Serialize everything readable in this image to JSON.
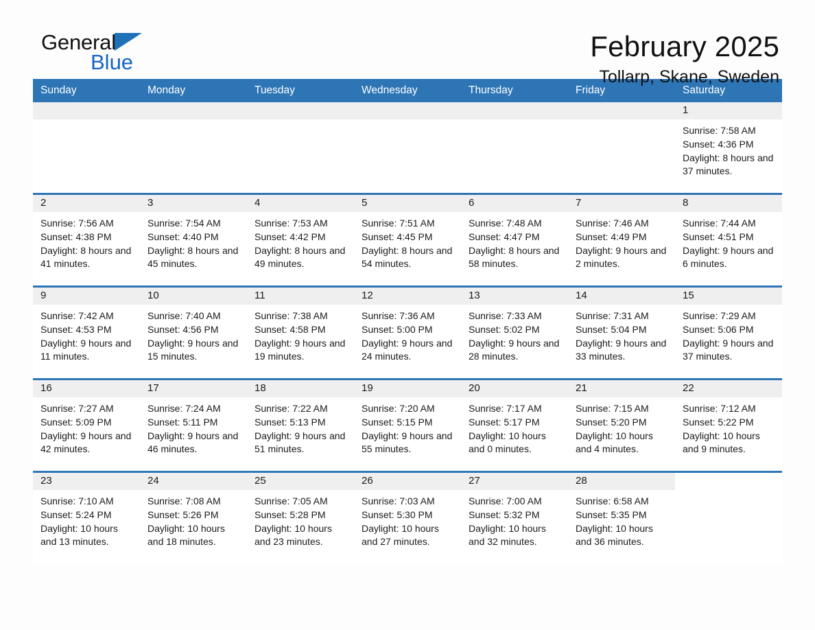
{
  "brand": {
    "name_part1": "General",
    "name_part2": "Blue",
    "logo_icon": "triangle-flag-icon"
  },
  "header": {
    "month_title": "February 2025",
    "location": "Tollarp, Skane, Sweden"
  },
  "colors": {
    "header_blue": "#2e75b6",
    "brand_blue": "#1565c0",
    "daynum_band": "#efefef",
    "page_background": "#fdfdfd"
  },
  "calendar": {
    "weekdays": [
      "Sunday",
      "Monday",
      "Tuesday",
      "Wednesday",
      "Thursday",
      "Friday",
      "Saturday"
    ],
    "labels": {
      "sunrise": "Sunrise:",
      "sunset": "Sunset:",
      "daylight": "Daylight:"
    },
    "weeks": [
      [
        {
          "day": "",
          "sunrise": "",
          "sunset": "",
          "daylight": "",
          "blank": true
        },
        {
          "day": "",
          "sunrise": "",
          "sunset": "",
          "daylight": "",
          "blank": true
        },
        {
          "day": "",
          "sunrise": "",
          "sunset": "",
          "daylight": "",
          "blank": true
        },
        {
          "day": "",
          "sunrise": "",
          "sunset": "",
          "daylight": "",
          "blank": true
        },
        {
          "day": "",
          "sunrise": "",
          "sunset": "",
          "daylight": "",
          "blank": true
        },
        {
          "day": "",
          "sunrise": "",
          "sunset": "",
          "daylight": "",
          "blank": true
        },
        {
          "day": "1",
          "sunrise": "Sunrise: 7:58 AM",
          "sunset": "Sunset: 4:36 PM",
          "daylight": "Daylight: 8 hours and 37 minutes."
        }
      ],
      [
        {
          "day": "2",
          "sunrise": "Sunrise: 7:56 AM",
          "sunset": "Sunset: 4:38 PM",
          "daylight": "Daylight: 8 hours and 41 minutes."
        },
        {
          "day": "3",
          "sunrise": "Sunrise: 7:54 AM",
          "sunset": "Sunset: 4:40 PM",
          "daylight": "Daylight: 8 hours and 45 minutes."
        },
        {
          "day": "4",
          "sunrise": "Sunrise: 7:53 AM",
          "sunset": "Sunset: 4:42 PM",
          "daylight": "Daylight: 8 hours and 49 minutes."
        },
        {
          "day": "5",
          "sunrise": "Sunrise: 7:51 AM",
          "sunset": "Sunset: 4:45 PM",
          "daylight": "Daylight: 8 hours and 54 minutes."
        },
        {
          "day": "6",
          "sunrise": "Sunrise: 7:48 AM",
          "sunset": "Sunset: 4:47 PM",
          "daylight": "Daylight: 8 hours and 58 minutes."
        },
        {
          "day": "7",
          "sunrise": "Sunrise: 7:46 AM",
          "sunset": "Sunset: 4:49 PM",
          "daylight": "Daylight: 9 hours and 2 minutes."
        },
        {
          "day": "8",
          "sunrise": "Sunrise: 7:44 AM",
          "sunset": "Sunset: 4:51 PM",
          "daylight": "Daylight: 9 hours and 6 minutes."
        }
      ],
      [
        {
          "day": "9",
          "sunrise": "Sunrise: 7:42 AM",
          "sunset": "Sunset: 4:53 PM",
          "daylight": "Daylight: 9 hours and 11 minutes."
        },
        {
          "day": "10",
          "sunrise": "Sunrise: 7:40 AM",
          "sunset": "Sunset: 4:56 PM",
          "daylight": "Daylight: 9 hours and 15 minutes."
        },
        {
          "day": "11",
          "sunrise": "Sunrise: 7:38 AM",
          "sunset": "Sunset: 4:58 PM",
          "daylight": "Daylight: 9 hours and 19 minutes."
        },
        {
          "day": "12",
          "sunrise": "Sunrise: 7:36 AM",
          "sunset": "Sunset: 5:00 PM",
          "daylight": "Daylight: 9 hours and 24 minutes."
        },
        {
          "day": "13",
          "sunrise": "Sunrise: 7:33 AM",
          "sunset": "Sunset: 5:02 PM",
          "daylight": "Daylight: 9 hours and 28 minutes."
        },
        {
          "day": "14",
          "sunrise": "Sunrise: 7:31 AM",
          "sunset": "Sunset: 5:04 PM",
          "daylight": "Daylight: 9 hours and 33 minutes."
        },
        {
          "day": "15",
          "sunrise": "Sunrise: 7:29 AM",
          "sunset": "Sunset: 5:06 PM",
          "daylight": "Daylight: 9 hours and 37 minutes."
        }
      ],
      [
        {
          "day": "16",
          "sunrise": "Sunrise: 7:27 AM",
          "sunset": "Sunset: 5:09 PM",
          "daylight": "Daylight: 9 hours and 42 minutes."
        },
        {
          "day": "17",
          "sunrise": "Sunrise: 7:24 AM",
          "sunset": "Sunset: 5:11 PM",
          "daylight": "Daylight: 9 hours and 46 minutes."
        },
        {
          "day": "18",
          "sunrise": "Sunrise: 7:22 AM",
          "sunset": "Sunset: 5:13 PM",
          "daylight": "Daylight: 9 hours and 51 minutes."
        },
        {
          "day": "19",
          "sunrise": "Sunrise: 7:20 AM",
          "sunset": "Sunset: 5:15 PM",
          "daylight": "Daylight: 9 hours and 55 minutes."
        },
        {
          "day": "20",
          "sunrise": "Sunrise: 7:17 AM",
          "sunset": "Sunset: 5:17 PM",
          "daylight": "Daylight: 10 hours and 0 minutes."
        },
        {
          "day": "21",
          "sunrise": "Sunrise: 7:15 AM",
          "sunset": "Sunset: 5:20 PM",
          "daylight": "Daylight: 10 hours and 4 minutes."
        },
        {
          "day": "22",
          "sunrise": "Sunrise: 7:12 AM",
          "sunset": "Sunset: 5:22 PM",
          "daylight": "Daylight: 10 hours and 9 minutes."
        }
      ],
      [
        {
          "day": "23",
          "sunrise": "Sunrise: 7:10 AM",
          "sunset": "Sunset: 5:24 PM",
          "daylight": "Daylight: 10 hours and 13 minutes."
        },
        {
          "day": "24",
          "sunrise": "Sunrise: 7:08 AM",
          "sunset": "Sunset: 5:26 PM",
          "daylight": "Daylight: 10 hours and 18 minutes."
        },
        {
          "day": "25",
          "sunrise": "Sunrise: 7:05 AM",
          "sunset": "Sunset: 5:28 PM",
          "daylight": "Daylight: 10 hours and 23 minutes."
        },
        {
          "day": "26",
          "sunrise": "Sunrise: 7:03 AM",
          "sunset": "Sunset: 5:30 PM",
          "daylight": "Daylight: 10 hours and 27 minutes."
        },
        {
          "day": "27",
          "sunrise": "Sunrise: 7:00 AM",
          "sunset": "Sunset: 5:32 PM",
          "daylight": "Daylight: 10 hours and 32 minutes."
        },
        {
          "day": "28",
          "sunrise": "Sunrise: 6:58 AM",
          "sunset": "Sunset: 5:35 PM",
          "daylight": "Daylight: 10 hours and 36 minutes."
        },
        {
          "day": "",
          "sunrise": "",
          "sunset": "",
          "daylight": "",
          "empty": true
        }
      ]
    ]
  }
}
